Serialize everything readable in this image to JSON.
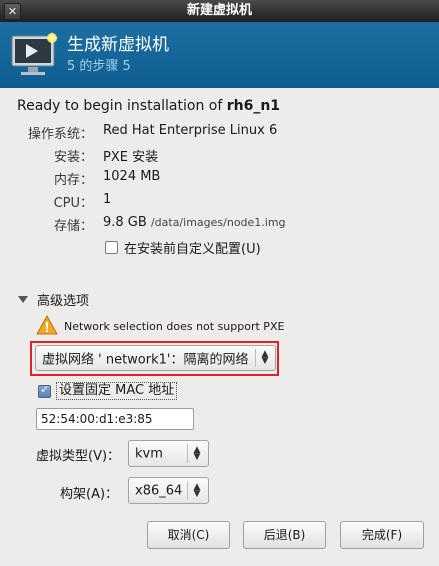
{
  "window": {
    "title": "新建虚拟机",
    "close_glyph": "✕"
  },
  "banner": {
    "title": "生成新虚拟机",
    "step": "5 的步骤 5",
    "icon": "monitor-star-icon",
    "color": "#1b6ca0"
  },
  "summary": {
    "ready_prefix": "Ready to begin installation of ",
    "vm_name": "rh6_n1",
    "rows": [
      {
        "label": "操作系统：",
        "value": "Red Hat Enterprise Linux 6"
      },
      {
        "label": "安装：",
        "value": "PXE 安装"
      },
      {
        "label": "内存：",
        "value": "1024 MB"
      },
      {
        "label": "CPU：",
        "value": "1"
      },
      {
        "label": "存储：",
        "value": "9.8 GB",
        "path": "/data/images/node1.img"
      }
    ],
    "customize_label": "在安装前自定义配置(U)",
    "customize_checked": false
  },
  "advanced": {
    "expander_label": "高级选项",
    "warning": "Network selection does not support PXE",
    "network": "虚拟网络 ' network1'：隔离的网络",
    "mac_label": "设置固定 MAC 地址",
    "mac_checked": true,
    "mac_value": "52:54:00:d1:e3:85",
    "virt_type_label": "虚拟类型(V)：",
    "virt_type": "kvm",
    "arch_label": "构架(A)：",
    "arch": "x86_64"
  },
  "buttons": {
    "cancel": "取消(C)",
    "back": "后退(B)",
    "finish": "完成(F)"
  },
  "colors": {
    "highlight_border": "#e0202a",
    "warning_fill": "#f5a623"
  }
}
